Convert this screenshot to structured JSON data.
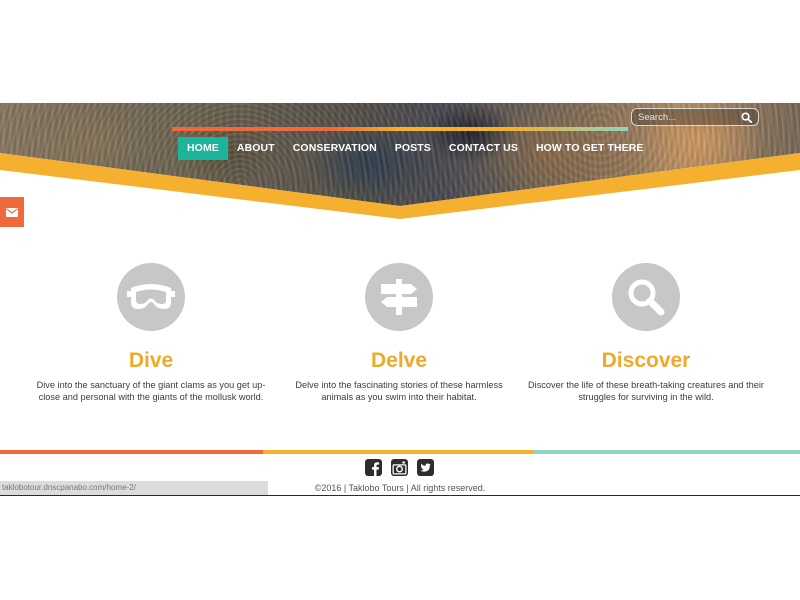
{
  "header": {
    "nav_items": [
      {
        "label": "HOME",
        "active": true
      },
      {
        "label": "ABOUT"
      },
      {
        "label": "CONSERVATION"
      },
      {
        "label": "POSTS"
      },
      {
        "label": "CONTACT US"
      },
      {
        "label": "HOW TO GET THERE"
      }
    ],
    "search": {
      "placeholder": "Search...",
      "icon": "search-icon"
    },
    "mail_tab_icon": "envelope-icon"
  },
  "features": [
    {
      "title": "Dive",
      "icon": "diving-mask-icon",
      "text": "Dive into the sanctuary of the giant clams as you get up-close and personal with the giants of the mollusk world."
    },
    {
      "title": "Delve",
      "icon": "signpost-icon",
      "text": "Delve into the fascinating stories of these harmless animals as you swim into their habitat."
    },
    {
      "title": "Discover",
      "icon": "magnifier-icon",
      "text": "Discover the life of these breath-taking creatures and their struggles for surviving in the wild."
    }
  ],
  "footer": {
    "social": [
      "facebook-icon",
      "instagram-icon",
      "twitter-icon"
    ],
    "copyright": "©2016 | Taklobo Tours | All rights reserved.",
    "stripe_colors": [
      "#ef6a3a",
      "#f4b02e",
      "#8fd3c1"
    ]
  },
  "status_bar": {
    "url": "taklobotour.dnscpanabo.com/home-2/"
  },
  "colors": {
    "accent_orange": "#ef6a3a",
    "accent_yellow": "#f4b02e",
    "accent_teal": "#1ab59a",
    "heading_gold": "#f0a92a",
    "icon_gray": "#c7c7c7"
  }
}
